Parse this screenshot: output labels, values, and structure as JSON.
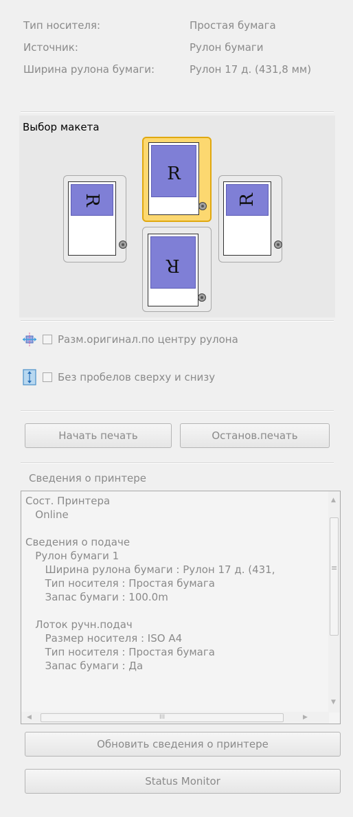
{
  "media_info": {
    "rows": [
      {
        "label": "Тип носителя:",
        "value": "Простая бумага"
      },
      {
        "label": "Источник:",
        "value": "Рулон бумаги"
      },
      {
        "label": "Ширина рулона бумаги:",
        "value": "Рулон 17 д. (431,8 мм)"
      }
    ]
  },
  "layout": {
    "title": "Выбор макета",
    "sheet_letter": "R",
    "selected": "top"
  },
  "options": {
    "center_label": "Разм.оригинал.по центру рулона",
    "borderless_label": "Без пробелов сверху и снизу"
  },
  "buttons": {
    "start_print": "Начать печать",
    "stop_print": "Останов.печать",
    "refresh": "Обновить сведения о принтере",
    "status_monitor": "Status Monitor"
  },
  "printer_info": {
    "group_label": "Сведения о принтере",
    "lines": [
      "Сост. Принтера",
      "   Online",
      "",
      "Сведения о подаче",
      "   Рулон бумаги 1",
      "      Ширина рулона бумаги : Рулон 17 д. (431,",
      "      Тип носителя : Простая бумага",
      "      Запас бумаги : 100.0m",
      "",
      "   Лоток ручн.подач",
      "      Размер носителя : ISO A4",
      "      Тип носителя : Простая бумага",
      "      Запас бумаги : Да"
    ]
  },
  "icons": {
    "center": "center-roll-icon",
    "borderless": "no-margin-icon",
    "scroll_up": "▲",
    "scroll_down": "▼",
    "scroll_left": "◀",
    "scroll_right": "▶",
    "scroll_grip_v": "≡",
    "scroll_grip_h": "III"
  },
  "colors": {
    "selected_border": "#e0a810",
    "selected_fill": "#fcd870",
    "sheet_blue": "#7f7fd6"
  }
}
